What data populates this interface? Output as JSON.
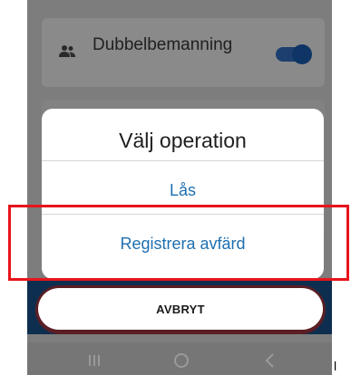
{
  "setting": {
    "label": "Dubbelbemanning",
    "icon": "people-icon",
    "toggle_state": "on",
    "toggle_color": "#0f3566"
  },
  "dialog": {
    "title": "Välj operation",
    "options": [
      {
        "label": "Lås"
      },
      {
        "label": "Registrera avfärd"
      }
    ],
    "option_color": "#1e6fb0"
  },
  "cancel": {
    "label": "AVBRYT"
  },
  "nav": {
    "items": [
      {
        "icon": "recent-apps-icon"
      },
      {
        "icon": "home-icon"
      },
      {
        "icon": "back-icon"
      }
    ]
  },
  "highlight": {
    "color": "#e8141b"
  },
  "stray_mark": {
    "text": "l"
  }
}
